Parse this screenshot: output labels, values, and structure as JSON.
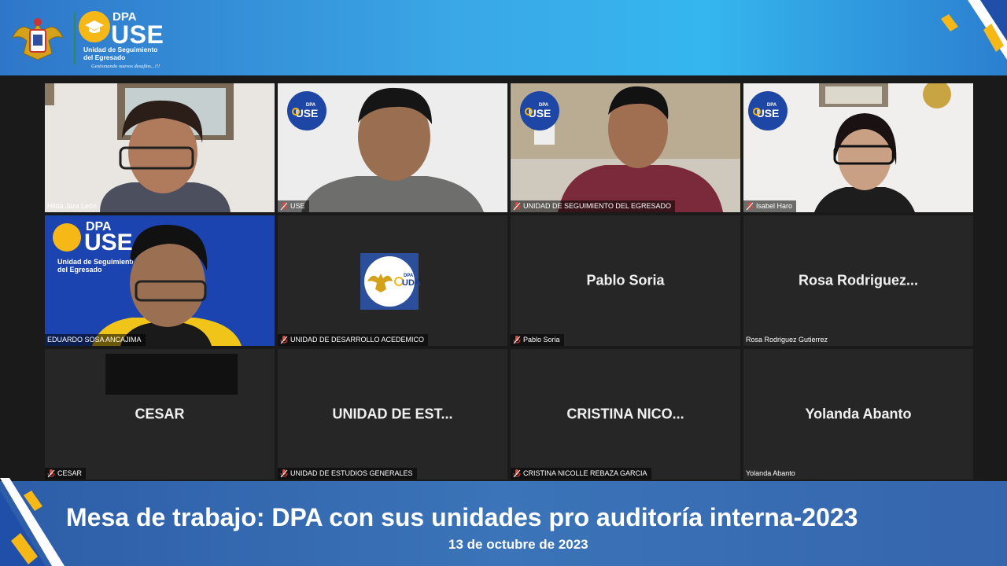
{
  "header": {
    "logo": {
      "dpa": "DPA",
      "use": "USE",
      "subtitle_line1": "Unidad de Seguimiento",
      "subtitle_line2": "del Egresado",
      "slogan": "Gestionando nuevos desafíos...!!!"
    }
  },
  "participants": [
    {
      "name_tag": "Hilda  Jara  León",
      "mic_muted": false,
      "display": "video"
    },
    {
      "name_tag": "USE",
      "mic_muted": true,
      "display": "video"
    },
    {
      "name_tag": "UNIDAD DE SEGUIMIENTO DEL EGRESADO",
      "mic_muted": true,
      "display": "video"
    },
    {
      "name_tag": "Isabel Haro",
      "mic_muted": true,
      "display": "video"
    },
    {
      "name_tag": "EDUARDO SOSA ANCAJIMA",
      "mic_muted": false,
      "display": "video",
      "active_speaker": true,
      "background_text": {
        "dpa": "DPA",
        "use": "USE",
        "line1": "Unidad de Seguimiento",
        "line2": "del Egresado"
      }
    },
    {
      "name_tag": "UNIDAD DE DESARROLLO ACEDEMICO",
      "mic_muted": true,
      "display": "logo",
      "logo_text": {
        "dpa": "DPA",
        "uda": "UDA"
      }
    },
    {
      "name_tag": "Pablo Soria",
      "mic_muted": true,
      "display": "name",
      "center_name": "Pablo Soria"
    },
    {
      "name_tag": "Rosa Rodriguez Gutierrez",
      "mic_muted": false,
      "display": "name",
      "center_name": "Rosa  Rodriguez..."
    },
    {
      "name_tag": "CESAR",
      "mic_muted": true,
      "display": "name",
      "center_name": "CESAR"
    },
    {
      "name_tag": "UNIDAD DE ESTUDIOS GENERALES",
      "mic_muted": true,
      "display": "name",
      "center_name": "UNIDAD DE EST..."
    },
    {
      "name_tag": "CRISTINA NICOLLE REBAZA GARCIA",
      "mic_muted": true,
      "display": "name",
      "center_name": "CRISTINA NICO..."
    },
    {
      "name_tag": "Yolanda Abanto",
      "mic_muted": false,
      "display": "name",
      "center_name": "Yolanda Abanto"
    }
  ],
  "badge": {
    "dpa": "DPA",
    "use": "USE"
  },
  "footer": {
    "title": "Mesa de trabajo: DPA con sus unidades pro auditoría interna-2023",
    "date": "13 de octubre de 2023"
  },
  "colors": {
    "active_speaker_border": "#c5e36a",
    "banner_blue": "#3aa7e6",
    "accent_yellow": "#f6b817",
    "mic_muted_red": "#e0483d"
  }
}
